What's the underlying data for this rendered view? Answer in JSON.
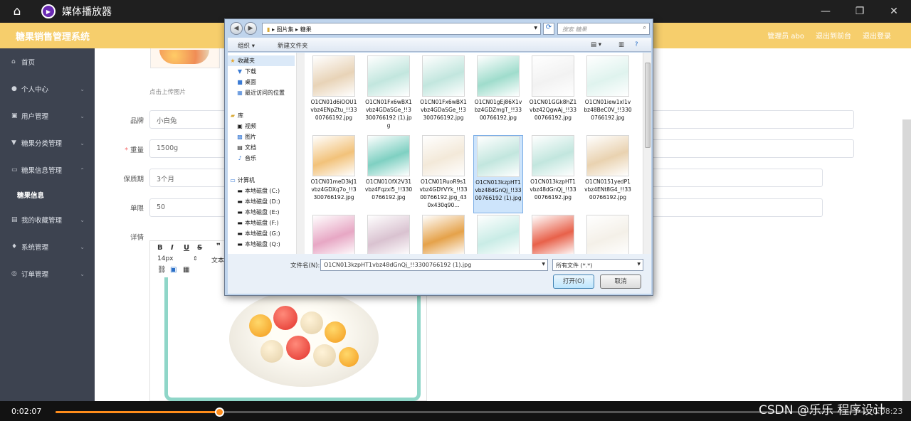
{
  "player": {
    "title": "媒体播放器",
    "home_icon": "home-icon",
    "window_buttons": [
      "minimize-icon",
      "restore-icon",
      "close-icon"
    ],
    "current_time": "0:02:07",
    "duration": "0:08:23",
    "progress": 0.203
  },
  "app": {
    "brand": "糖果销售管理系统",
    "user": "管理员 abo",
    "back_to_front": "退出到前台",
    "logout": "退出登录"
  },
  "sidebar": {
    "items": [
      {
        "label": "首页",
        "icon": "home-icon"
      },
      {
        "label": "个人中心",
        "icon": "user-icon",
        "arrow": "⌄"
      },
      {
        "label": "用户管理",
        "icon": "users-icon",
        "arrow": "⌄"
      },
      {
        "label": "糖果分类管理",
        "icon": "category-icon",
        "arrow": "⌄"
      },
      {
        "label": "糖果信息管理",
        "icon": "info-icon",
        "arrow": "⌃"
      },
      {
        "label": "糖果信息",
        "sub": true
      },
      {
        "label": "我的收藏管理",
        "icon": "star-icon",
        "arrow": "⌄"
      },
      {
        "label": "系统管理",
        "icon": "settings-icon",
        "arrow": "⌄"
      },
      {
        "label": "订单管理",
        "icon": "order-icon",
        "arrow": "⌄"
      }
    ]
  },
  "form": {
    "upload_hint": "点击上传图片",
    "brand_label": "品牌",
    "brand_value": "小白兔",
    "weight_label": "重量",
    "weight_value": "1500g",
    "shelf_label": "保质期",
    "shelf_value": "3个月",
    "limit_label": "单限",
    "limit_value": "50",
    "detail_label": "详情",
    "editor": {
      "bold": "B",
      "italic": "I",
      "underline": "U",
      "strike": "S",
      "quote": "❞",
      "font_size": "14px",
      "text": "文本"
    }
  },
  "dialog": {
    "path": [
      "图片集",
      "糖果"
    ],
    "search_placeholder": "搜索 糖果",
    "organize": "组织 ▾",
    "new_folder": "新建文件夹",
    "nav": {
      "favorites": "收藏夹",
      "downloads": "下载",
      "desktop": "桌面",
      "recent": "最近访问的位置",
      "libraries": "库",
      "videos": "视频",
      "pictures": "图片",
      "documents": "文档",
      "music": "音乐",
      "computer": "计算机",
      "drives": [
        "本地磁盘 (C:)",
        "本地磁盘 (D:)",
        "本地磁盘 (E:)",
        "本地磁盘 (F:)",
        "本地磁盘 (G:)",
        "本地磁盘 (Q:)"
      ]
    },
    "files": [
      {
        "name": "O1CN01d6iOOU1vbz4ENpZtu_!!3300766192.jpg",
        "color": "#e8d3b7"
      },
      {
        "name": "O1CN01Fx6wBX1vbz4GDaSGe_!!3300766192 (1).jpg",
        "color": "#c2e6de"
      },
      {
        "name": "O1CN01Fx6wBX1vbz4GDaSGe_!!3300766192.jpg",
        "color": "#c2e6de"
      },
      {
        "name": "O1CN01gEj86X1vbz4GDZmgT_!!3300766192.jpg",
        "color": "#9fdccc"
      },
      {
        "name": "O1CN01GGk8hZ1vbz42QgwAj_!!3300766192.jpg",
        "color": "#f2f2f2"
      },
      {
        "name": "O1CN01iew1xl1vbz48BeC0V_!!3300766192.jpg",
        "color": "#dff3ee"
      },
      {
        "name": "O1CN01meD3kJ1vbz4GDXq7o_!!3300766192.jpg",
        "color": "#f2c27a"
      },
      {
        "name": "O1CN01OfX2V31vbz4Fqzxl5_!!3300766192.jpg",
        "color": "#7fd0c2"
      },
      {
        "name": "O1CN01RuoR9s1vbz4GDYVYk_!!3300766192.jpg_430x430q90...",
        "color": "#f3e9d9"
      },
      {
        "name": "O1CN013kzpHT1vbz48dGnQj_!!3300766192 (1).jpg",
        "color": "#c2e6de",
        "selected": true
      },
      {
        "name": "O1CN013kzpHT1vbz48dGnQj_!!3300766192.jpg",
        "color": "#c2e6de"
      },
      {
        "name": "O1CN0151yedP1vbz4ENt8G4_!!3300766192.jpg",
        "color": "#e9d2b0"
      },
      {
        "name": "",
        "color": "#e7a7c4"
      },
      {
        "name": "",
        "color": "#d9c2d0"
      },
      {
        "name": "",
        "color": "#e5a24a"
      },
      {
        "name": "",
        "color": "#c9ece6"
      },
      {
        "name": "",
        "color": "#e8614a"
      },
      {
        "name": "",
        "color": "#f4f0e8"
      }
    ],
    "filename_label": "文件名(N):",
    "filename_value": "O1CN013kzpHT1vbz48dGnQj_!!3300766192 (1).jpg",
    "filetype": "所有文件 (*.*)",
    "open": "打开(O)",
    "cancel": "取消"
  },
  "watermark": "CSDN @乐乐 程序设计"
}
